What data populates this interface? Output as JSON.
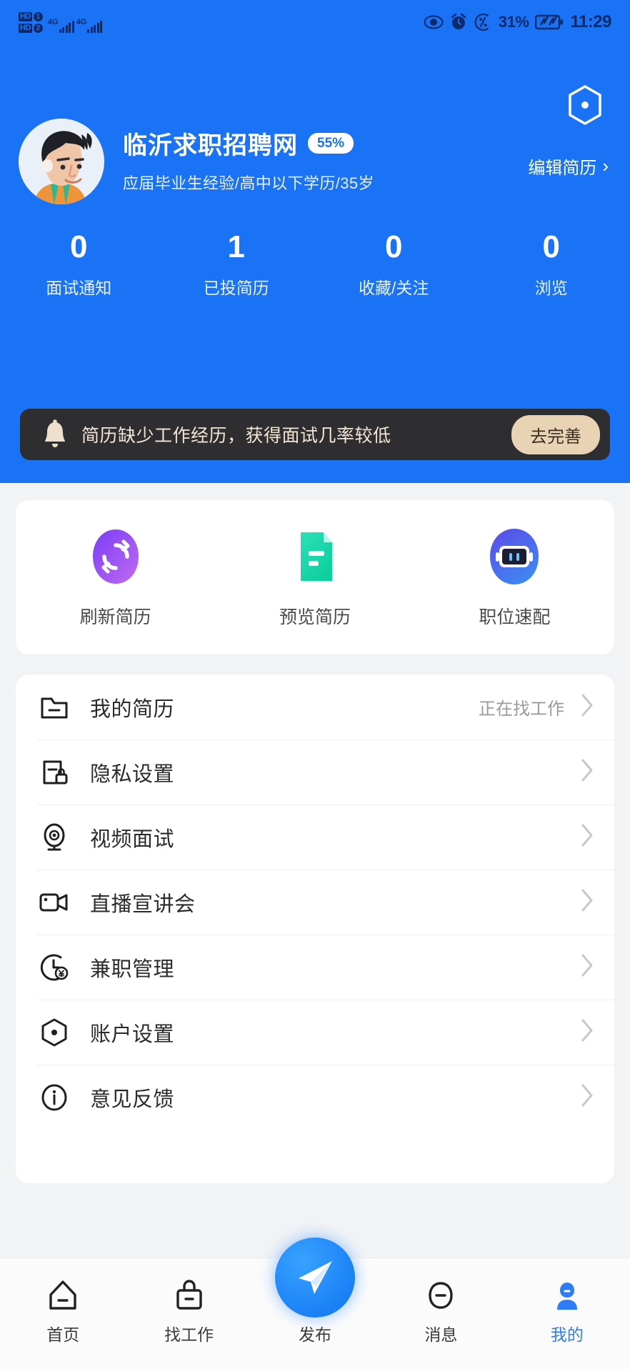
{
  "status_bar": {
    "hd1_label": "HD",
    "hd1_num": "1",
    "hd2_label": "HD",
    "hd2_num": "2",
    "net1": "4G",
    "net2": "4G",
    "battery_percent": "31%",
    "time": "11:29"
  },
  "header": {
    "settings_icon": "hexagon-settings-icon",
    "avatar": "user-avatar",
    "name": "临沂求职招聘网",
    "completion_badge": "55%",
    "subtitle": "应届毕业生经验/高中以下学历/35岁",
    "edit_resume": "编辑简历",
    "edit_chevron": "›",
    "stats": [
      {
        "value": "0",
        "label": "面试通知"
      },
      {
        "value": "1",
        "label": "已投简历"
      },
      {
        "value": "0",
        "label": "收藏/关注"
      },
      {
        "value": "0",
        "label": "浏览"
      }
    ],
    "alert": {
      "icon": "bell-icon",
      "text": "简历缺少工作经历，获得面试几率较低",
      "button": "去完善"
    }
  },
  "quick_actions": [
    {
      "label": "刷新简历",
      "icon": "refresh-icon",
      "color": "#8b4ff0"
    },
    {
      "label": "预览简历",
      "icon": "document-icon",
      "color": "#18dcb0"
    },
    {
      "label": "职位速配",
      "icon": "robot-icon",
      "color": "#4a63e8"
    }
  ],
  "menu_items": [
    {
      "label": "我的简历",
      "icon": "folder-icon",
      "value": "正在找工作"
    },
    {
      "label": "隐私设置",
      "icon": "privacy-lock-icon",
      "value": ""
    },
    {
      "label": "视频面试",
      "icon": "webcam-icon",
      "value": ""
    },
    {
      "label": "直播宣讲会",
      "icon": "video-camera-icon",
      "value": ""
    },
    {
      "label": "兼职管理",
      "icon": "clock-yen-icon",
      "value": ""
    },
    {
      "label": "账户设置",
      "icon": "hexagon-dot-icon",
      "value": ""
    },
    {
      "label": "意见反馈",
      "icon": "info-icon",
      "value": ""
    }
  ],
  "tabbar": [
    {
      "label": "首页",
      "icon": "home-icon",
      "active": false
    },
    {
      "label": "找工作",
      "icon": "briefcase-icon",
      "active": false
    },
    {
      "label": "发布",
      "icon": "send-icon",
      "active": false
    },
    {
      "label": "消息",
      "icon": "message-icon",
      "active": false
    },
    {
      "label": "我的",
      "icon": "person-icon",
      "active": true
    }
  ],
  "colors": {
    "brand_blue": "#1a73f5",
    "accent_blue": "#2d7df6",
    "alert_bg": "#2e2e30",
    "alert_btn": "#e8d4b4"
  }
}
